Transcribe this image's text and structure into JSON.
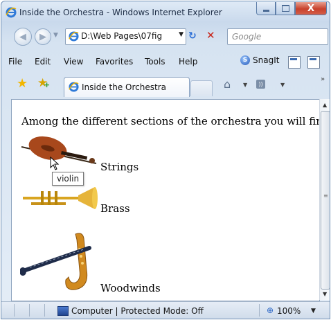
{
  "window": {
    "title": "Inside the Orchestra - Windows Internet Explorer",
    "caption": {
      "minimize": "–",
      "maximize": "□",
      "close": "X"
    }
  },
  "addressbar": {
    "url": "D:\\Web Pages\\07fig",
    "search_placeholder": "Google"
  },
  "menu": {
    "items": [
      "File",
      "Edit",
      "View",
      "Favorites",
      "Tools",
      "Help"
    ],
    "snagit_label": "SnagIt"
  },
  "tab": {
    "title": "Inside the Orchestra"
  },
  "page": {
    "intro": "Among the different sections of the orchestra you will find:",
    "sections": [
      {
        "label": "Strings",
        "image": "violin"
      },
      {
        "label": "Brass",
        "image": "trumpet"
      },
      {
        "label": "Woodwinds",
        "image": "clarinet-and-saxophone"
      }
    ],
    "tooltip": "violin"
  },
  "statusbar": {
    "zone": "Computer | Protected Mode: Off",
    "zoom": "100%"
  },
  "icons": {
    "ie": "internet-explorer-icon",
    "refresh": "refresh-icon",
    "stop": "stop-icon",
    "home": "home-icon",
    "feeds": "feeds-icon",
    "favorites": "favorites-star-icon",
    "add_favorite": "add-favorite-icon",
    "zoom": "zoom-icon"
  },
  "colors": {
    "chrome_blue": "#c9d9ec",
    "close_red": "#c8412c",
    "page_bg": "#ffffff"
  }
}
